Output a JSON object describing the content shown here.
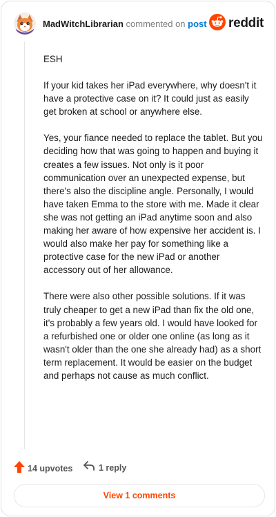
{
  "comment": {
    "author": "MadWitchLibrarian",
    "action_text": "commented on",
    "link_text": "post",
    "paragraphs": [
      "ESH",
      "If your kid takes her iPad everywhere, why doesn't it have a protective case on it? It could just as easily get broken at school or anywhere else.",
      "Yes, your fiance needed to replace the tablet. But you deciding how that was going to happen and buying it creates a few issues. Not only is it poor communication over an unexpected expense, but there's also the discipline angle. Personally, I would have taken Emma to the store with me. Made it clear she was not getting an iPad anytime soon and also making her aware of how expensive her accident is. I would also make her pay for something like a protective case for the new iPad or another accessory out of her allowance.",
      "There were also other possible solutions. If it was truly cheaper to get a new iPad than fix the old one, it's probably a few years old. I would have looked for a refurbished one or older one online (as long as it wasn't older than the one she already had) as a short term replacement. It would be easier on the budget and perhaps not cause as much conflict."
    ]
  },
  "brand": {
    "name": "reddit",
    "color": "#ff4500"
  },
  "footer": {
    "upvotes_label": "14 upvotes",
    "replies_label": "1 reply",
    "view_comments_label": "View 1 comments"
  },
  "icons": {
    "avatar": "avatar-icon",
    "logo": "reddit-logo-icon",
    "upvote": "upvote-arrow-icon",
    "reply": "reply-arrow-icon"
  }
}
